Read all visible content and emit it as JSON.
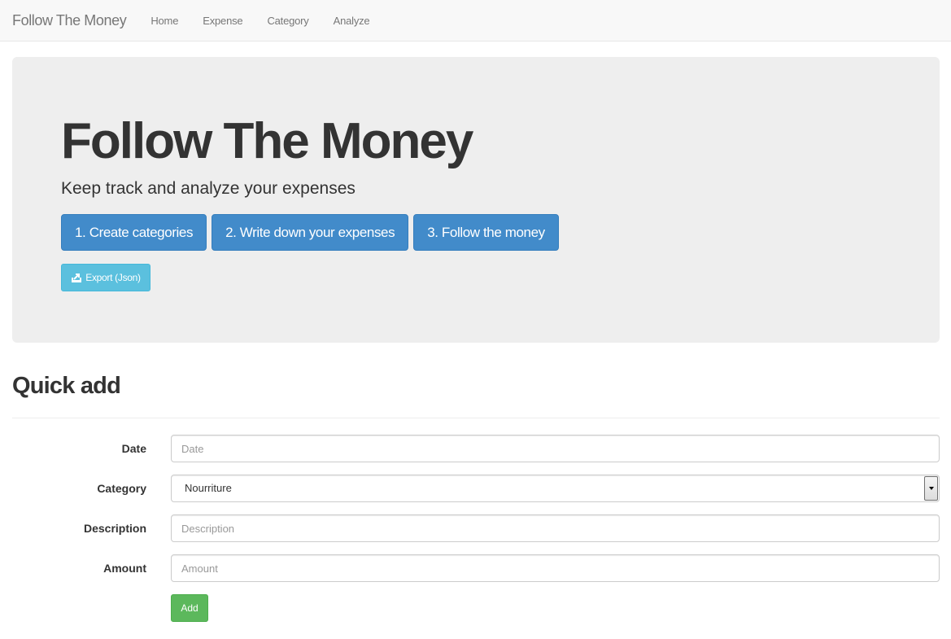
{
  "navbar": {
    "brand": "Follow The Money",
    "links": [
      "Home",
      "Expense",
      "Category",
      "Analyze"
    ]
  },
  "jumbotron": {
    "title": "Follow The Money",
    "subtitle": "Keep track and analyze your expenses",
    "steps": [
      "1. Create categories",
      "2. Write down your expenses",
      "3. Follow the money"
    ],
    "export_label": "Export (Json)",
    "export_icon": "export-icon"
  },
  "quick_add": {
    "title": "Quick add",
    "date": {
      "label": "Date",
      "placeholder": "Date",
      "value": ""
    },
    "category": {
      "label": "Category",
      "selected": "Nourriture"
    },
    "description": {
      "label": "Description",
      "placeholder": "Description",
      "value": ""
    },
    "amount": {
      "label": "Amount",
      "placeholder": "Amount",
      "value": ""
    },
    "add_label": "Add"
  },
  "colors": {
    "primary": "#428bca",
    "info": "#5bc0de",
    "success": "#5cb85c",
    "jumbotron_bg": "#eeeeee",
    "navbar_bg": "#f8f8f8"
  }
}
